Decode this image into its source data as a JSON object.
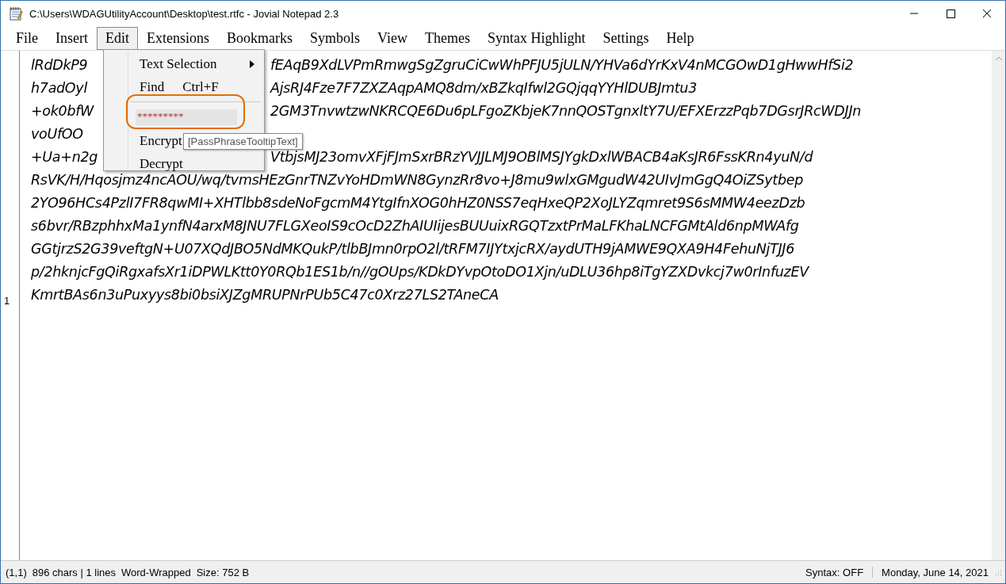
{
  "window": {
    "title": "C:\\Users\\WDAGUtilityAccount\\Desktop\\test.rtfc - Jovial Notepad 2.3"
  },
  "menu_bar": [
    {
      "label": "File",
      "selected": false
    },
    {
      "label": "Insert",
      "selected": false
    },
    {
      "label": "Edit",
      "selected": true
    },
    {
      "label": "Extensions",
      "selected": false
    },
    {
      "label": "Bookmarks",
      "selected": false
    },
    {
      "label": "Symbols",
      "selected": false
    },
    {
      "label": "View",
      "selected": false
    },
    {
      "label": "Themes",
      "selected": false
    },
    {
      "label": "Syntax Highlight",
      "selected": false
    },
    {
      "label": "Settings",
      "selected": false
    },
    {
      "label": "Help",
      "selected": false
    }
  ],
  "edit_menu": {
    "items": [
      {
        "kind": "submenu",
        "label": "Text Selection"
      },
      {
        "kind": "command",
        "label": "Find",
        "shortcut": "Ctrl+F"
      },
      {
        "kind": "separator"
      },
      {
        "kind": "password",
        "value": "*********"
      },
      {
        "kind": "command",
        "label": "Encrypt"
      },
      {
        "kind": "command",
        "label": "Decrypt"
      }
    ],
    "tooltip": "[PassPhraseTooltipText]"
  },
  "editor": {
    "lines": [
      {
        "left": "lRdDkP9",
        "right": "fEAqB9XdLVPmRmwgSgZgruCiCwWhPFJU5jULN/YHVa6dYrKxV4nMCGOwD1gHwwHfSi2"
      },
      {
        "left": "h7adOyl",
        "right": "AjsRJ4Fze7F7ZXZAqpAMQ8dm/xBZkqIfwl2GQjqqYYHlDUBJmtu3"
      },
      {
        "left": "+ok0bfW",
        "right": "2GM3TnvwtzwNKRCQE6Du6pLFgoZKbjeK7nnQOSTgnxltY7U/EFXErzzPqb7DGsrJRcWDJJn"
      },
      {
        "left": "voUfOO"
      },
      {
        "left": "+Ua+n2g",
        "right": "VtbjsMJ23omvXFjFJmSxrBRzYVJJLMJ9OBlMSJYgkDxlWBACB4aKsJR6FssKRn4yuN/d"
      },
      {
        "text": "RsVK/H/Hqosjmz4ncAOU/wq/tvmsHEzGnrTNZvYoHDmWN8GynzRr8vo+J8mu9wlxGMgudW42UIvJmGgQ4OiZSytbep"
      },
      {
        "text": "2YO96HCs4PzlI7FR8qwMI+XHTlbb8sdeNoFgcmM4YtgIfnXOG0hHZ0NSS7eqHxeQP2XoJLYZqmret9S6sMMW4eezDzb"
      },
      {
        "text": "s6bvr/RBzphhxMa1ynfN4arxM8JNU7FLGXeoIS9cOcD2ZhAIUIijesBUUuixRGQTzxtPrMaLFKhaLNCFGMtAld6npMWAfg"
      },
      {
        "text": "GGtjrzS2G39veftgN+U07XQdJBO5NdMKQukP/tlbBJmn0rpO2l/tRFM7IJYtxjcRX/aydUTH9jAMWE9QXA9H4FehuNjTJJ6"
      },
      {
        "text": "p/2hknjcFgQiRgxafsXr1iDPWLKtt0Y0RQb1ES1b/n//gOUps/KDkDYvpOtoDO1Xjn/uDLU36hp8iTgYZXDvkcj7w0rInfuzEV"
      },
      {
        "text": "KmrtBAs6n3uPuxyys8bi0bsiXJZgMRUPNrPUb5C47c0Xrz27LS2TAneCA",
        "line_number": "1"
      }
    ]
  },
  "status_bar": {
    "position": "(1,1)",
    "counts": "896 chars | 1 lines",
    "wrap": "Word-Wrapped",
    "size": "Size: 752 B",
    "syntax": "Syntax: OFF",
    "date": "Monday, June 14, 2021"
  }
}
